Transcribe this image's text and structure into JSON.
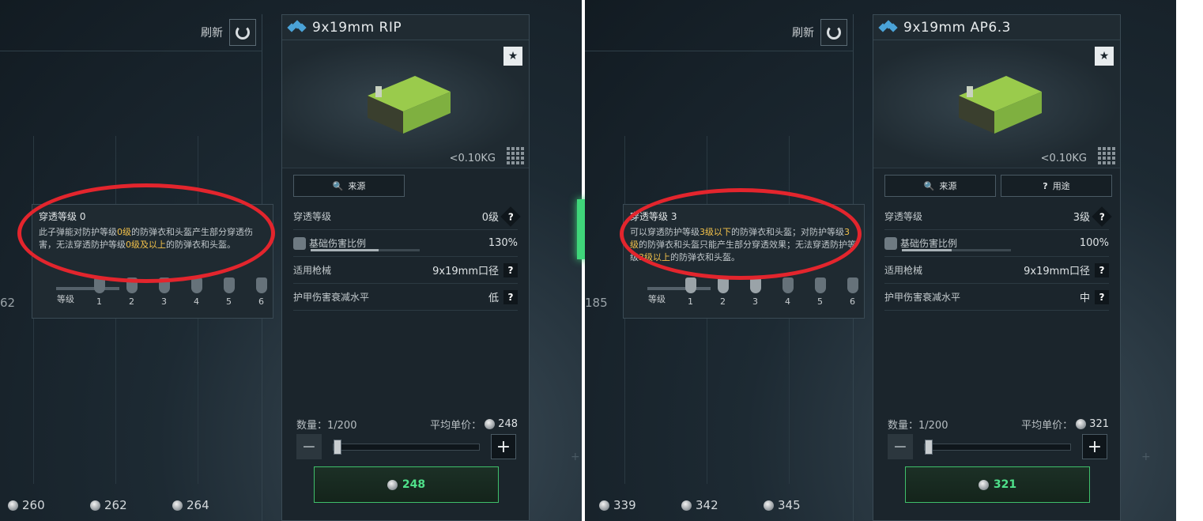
{
  "left": {
    "refresh_label": "刷新",
    "axis_value": "62",
    "prices": [
      "260",
      "262",
      "264"
    ],
    "tooltip": {
      "title": "穿透等级 0",
      "desc_parts": [
        {
          "t": "此子弹能对防护等级",
          "hl": false
        },
        {
          "t": "0级",
          "hl": true
        },
        {
          "t": "的防弹衣和头盔产生部分穿透伤害，无法穿透防护等级",
          "hl": false
        },
        {
          "t": "0级及以上",
          "hl": true
        },
        {
          "t": "的防弹衣和头盔。",
          "hl": false
        }
      ],
      "level_label": "等级",
      "levels": [
        "1",
        "2",
        "3",
        "4",
        "5",
        "6"
      ],
      "active_levels": 0
    },
    "card": {
      "title": "9x19mm RIP",
      "weight": "<0.10KG",
      "buttons": [
        {
          "label": "来源",
          "icon": "search-icon"
        }
      ],
      "stats": {
        "penetration_label": "穿透等级",
        "penetration_value": "0级",
        "damage_label": "基础伤害比例",
        "damage_value": "130%",
        "damage_fraction": 0.62,
        "weapon_label": "适用枪械",
        "weapon_value": "9x19mm口径",
        "armor_label": "护甲伤害衰减水平",
        "armor_value": "低"
      },
      "qty_label": "数量：1/200",
      "avg_label": "平均单价：",
      "avg_price": "248",
      "buy_price": "248"
    }
  },
  "right": {
    "refresh_label": "刷新",
    "axis_value": "185",
    "prices": [
      "339",
      "342",
      "345"
    ],
    "tooltip": {
      "title": "穿透等级 3",
      "desc_parts": [
        {
          "t": "可以穿透防护等级",
          "hl": false
        },
        {
          "t": "3级以下",
          "hl": true
        },
        {
          "t": "的防弹衣和头盔；对防护等级",
          "hl": false
        },
        {
          "t": "3级",
          "hl": true
        },
        {
          "t": "的防弹衣和头盔只能产生部分穿透效果；无法穿透防护等级",
          "hl": false
        },
        {
          "t": "3级以上",
          "hl": true
        },
        {
          "t": "的防弹衣和头盔。",
          "hl": false
        }
      ],
      "level_label": "等级",
      "levels": [
        "1",
        "2",
        "3",
        "4",
        "5",
        "6"
      ],
      "active_levels": 3
    },
    "card": {
      "title": "9x19mm AP6.3",
      "weight": "<0.10KG",
      "buttons": [
        {
          "label": "来源",
          "icon": "search-icon"
        },
        {
          "label": "用途",
          "icon": "question-icon"
        }
      ],
      "stats": {
        "penetration_label": "穿透等级",
        "penetration_value": "3级",
        "damage_label": "基础伤害比例",
        "damage_value": "100%",
        "damage_fraction": 0.46,
        "weapon_label": "适用枪械",
        "weapon_value": "9x19mm口径",
        "armor_label": "护甲伤害衰减水平",
        "armor_value": "中"
      },
      "qty_label": "数量：1/200",
      "avg_label": "平均单价：",
      "avg_price": "321",
      "buy_price": "321"
    }
  },
  "colors": {
    "highlight": "#f2c14a",
    "buy_green": "#4fe08a",
    "annotation_red": "#e3252d",
    "divider_green": "#3fd67a"
  }
}
